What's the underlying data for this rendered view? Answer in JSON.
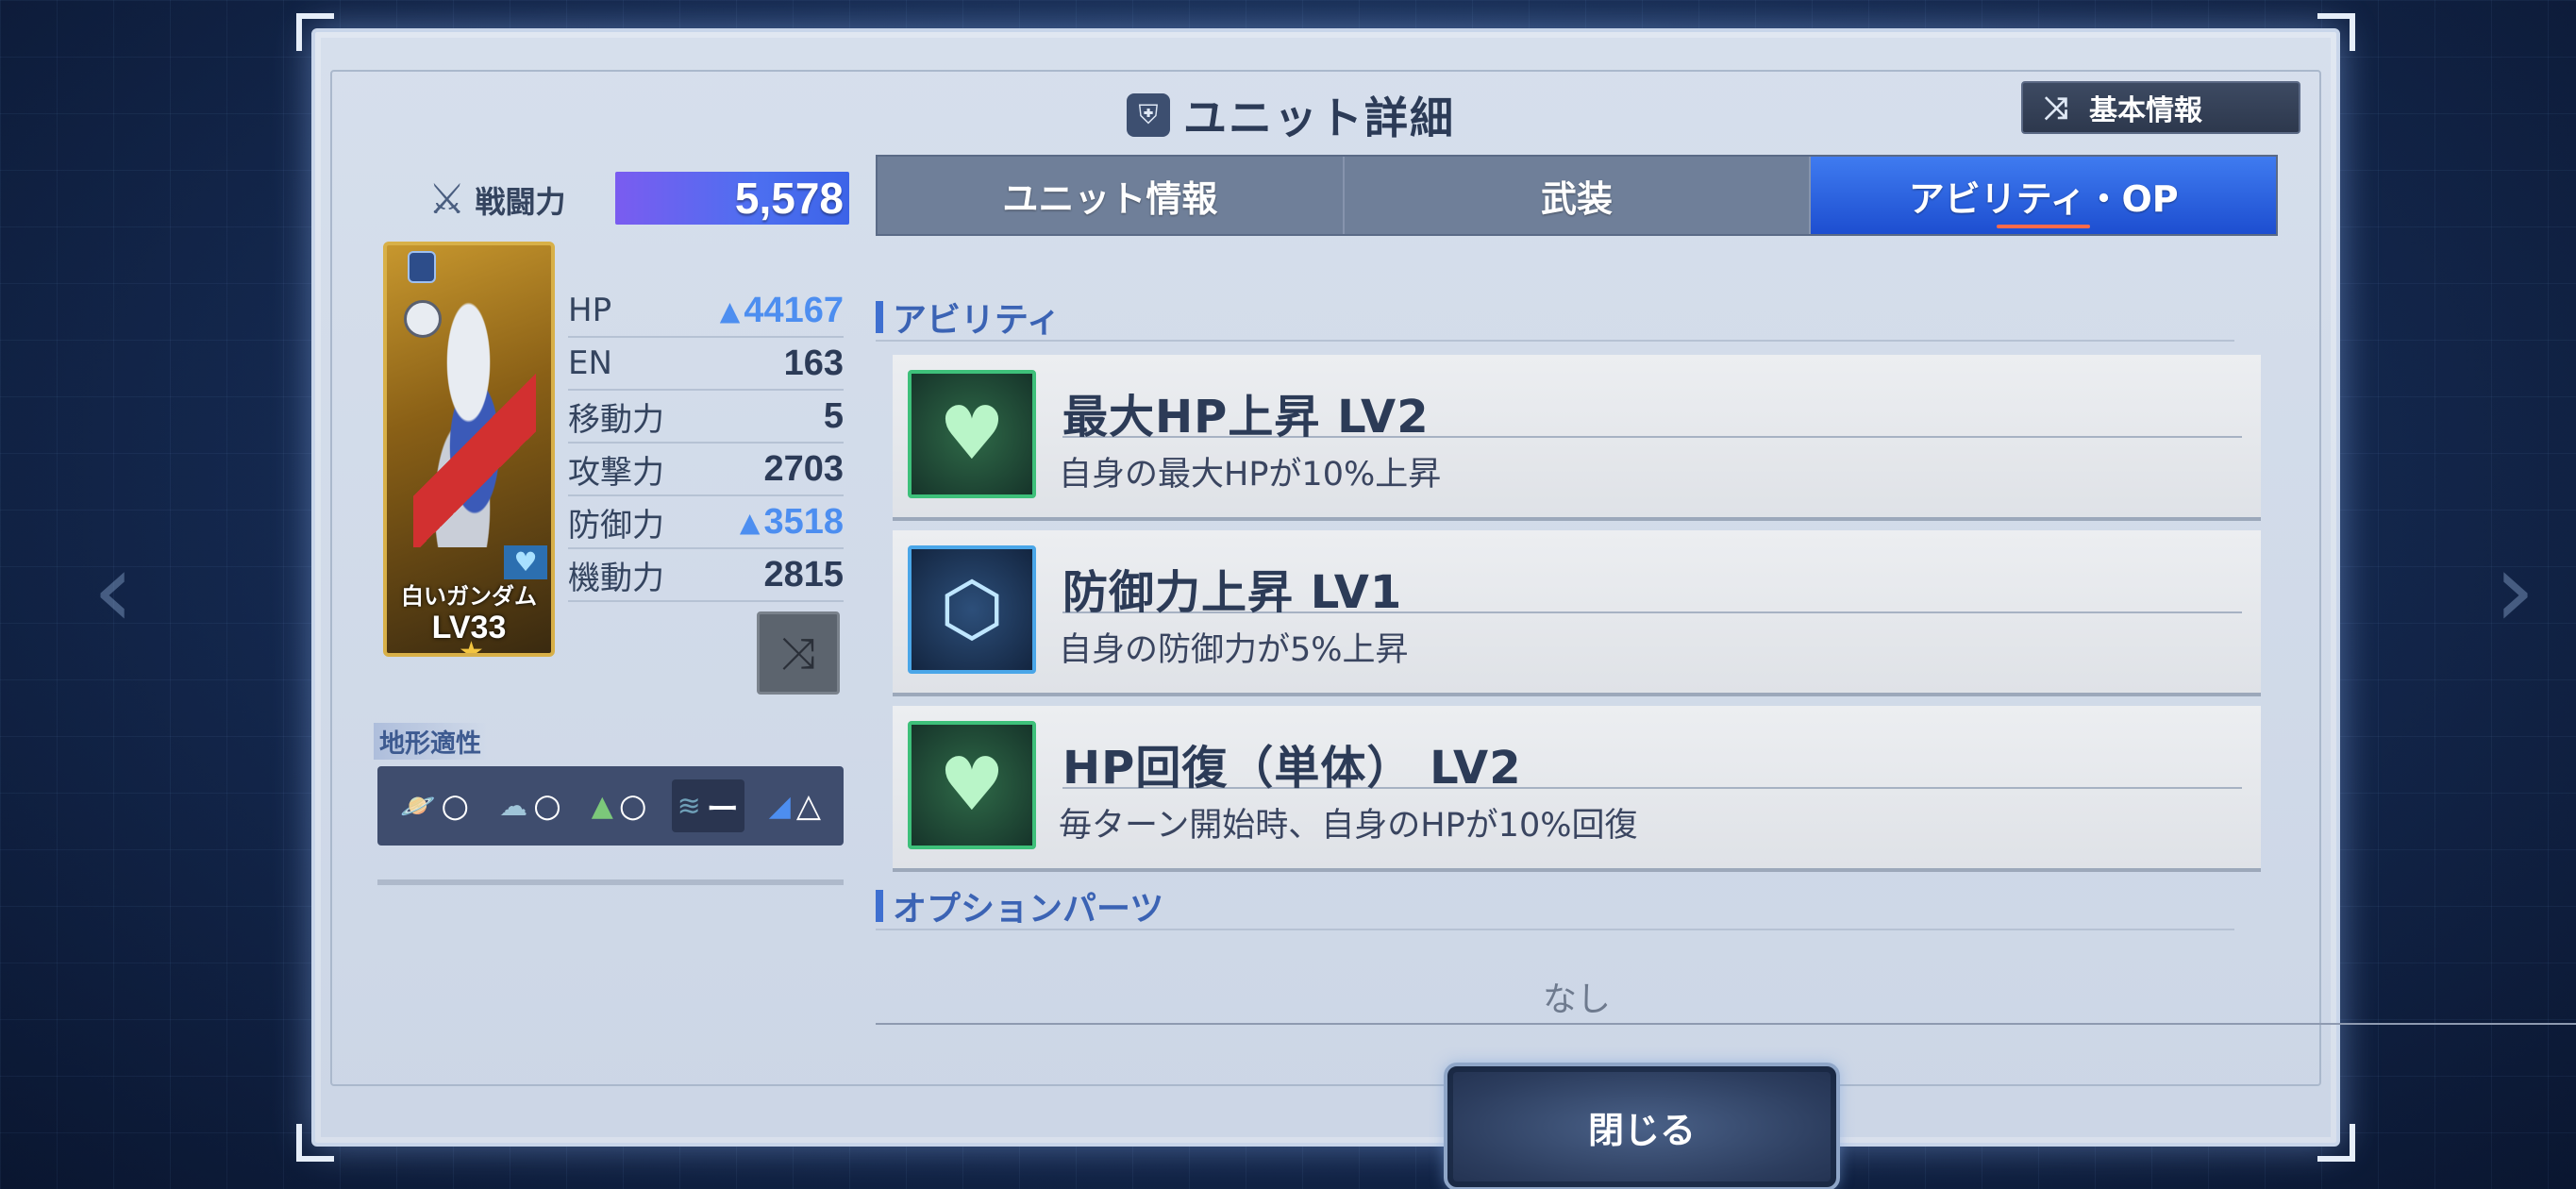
{
  "header": {
    "title": "ユニット詳細",
    "basic_info_button": "基本情報"
  },
  "unit": {
    "power_label": "戦闘力",
    "power_value": "5,578",
    "name": "白いガンダム",
    "level": "LV33",
    "stats": [
      {
        "label": "HP",
        "value": "44167",
        "boosted": true
      },
      {
        "label": "EN",
        "value": "163",
        "boosted": false
      },
      {
        "label": "移動力",
        "value": "5",
        "boosted": false
      },
      {
        "label": "攻撃力",
        "value": "2703",
        "boosted": false
      },
      {
        "label": "防御力",
        "value": "3518",
        "boosted": true
      },
      {
        "label": "機動力",
        "value": "2815",
        "boosted": false
      }
    ]
  },
  "terrain": {
    "label": "地形適性",
    "items": [
      {
        "icon": "space-icon",
        "grade": "○"
      },
      {
        "icon": "air-icon",
        "grade": "○"
      },
      {
        "icon": "ground-icon",
        "grade": "○"
      },
      {
        "icon": "sea-icon",
        "grade": "ー"
      },
      {
        "icon": "underwater-icon",
        "grade": "△"
      }
    ]
  },
  "tabs": [
    {
      "label": "ユニット情報",
      "active": false
    },
    {
      "label": "武装",
      "active": false
    },
    {
      "label": "アビリティ・OP",
      "active": true
    }
  ],
  "abilities_section": {
    "title": "アビリティ",
    "items": [
      {
        "name": "最大HP上昇 LV2",
        "desc": "自身の最大HPが10%上昇",
        "icon": "heart-icon",
        "color": "#3ec07a"
      },
      {
        "name": "防御力上昇 LV1",
        "desc": "自身の防御力が5%上昇",
        "icon": "shield-icon",
        "color": "#4aa6e8"
      },
      {
        "name": "HP回復（単体） LV2",
        "desc": "毎ターン開始時、自身のHPが10%回復",
        "icon": "sparkle-heart-icon",
        "color": "#3ec07a"
      }
    ]
  },
  "options_section": {
    "title": "オプションパーツ",
    "empty_text": "なし"
  },
  "close_button": "閉じる"
}
